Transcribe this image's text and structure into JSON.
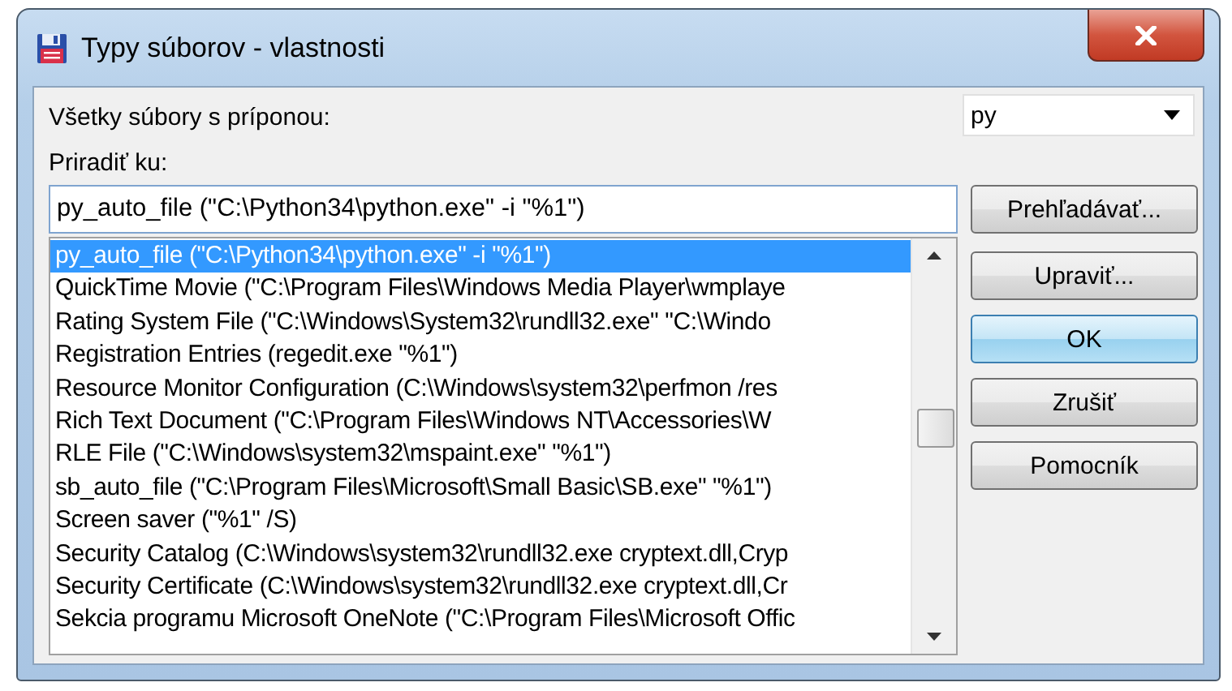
{
  "window": {
    "title": "Typy súborov - vlastnosti"
  },
  "extension_label": "Všetky súbory s príponou:",
  "extension_select": {
    "value": "py"
  },
  "assign_label": "Priradiť ku:",
  "assign_field": {
    "value": "py_auto_file (\"C:\\Python34\\python.exe\" -i \"%1\")"
  },
  "file_types": [
    {
      "text": "py_auto_file (\"C:\\Python34\\python.exe\" -i \"%1\")",
      "selected": true
    },
    {
      "text": "QuickTime Movie (\"C:\\Program Files\\Windows Media Player\\wmplaye",
      "selected": false
    },
    {
      "text": "Rating System File (\"C:\\Windows\\System32\\rundll32.exe\" \"C:\\Windo",
      "selected": false
    },
    {
      "text": "Registration Entries (regedit.exe \"%1\")",
      "selected": false
    },
    {
      "text": "Resource Monitor Configuration (C:\\Windows\\system32\\perfmon /res",
      "selected": false
    },
    {
      "text": "Rich Text Document (\"C:\\Program Files\\Windows NT\\Accessories\\W",
      "selected": false
    },
    {
      "text": "RLE File (\"C:\\Windows\\system32\\mspaint.exe\" \"%1\")",
      "selected": false
    },
    {
      "text": "sb_auto_file (\"C:\\Program Files\\Microsoft\\Small Basic\\SB.exe\" \"%1\")",
      "selected": false
    },
    {
      "text": "Screen saver (\"%1\" /S)",
      "selected": false
    },
    {
      "text": "Security Catalog (C:\\Windows\\system32\\rundll32.exe cryptext.dll,Cryp",
      "selected": false
    },
    {
      "text": "Security Certificate (C:\\Windows\\system32\\rundll32.exe cryptext.dll,Cr",
      "selected": false
    },
    {
      "text": "Sekcia programu Microsoft OneNote (\"C:\\Program Files\\Microsoft Offic",
      "selected": false
    }
  ],
  "buttons": [
    {
      "label": "Prehľadávať...",
      "default": false
    },
    {
      "label": "Upraviť...",
      "default": false
    },
    {
      "label": "OK",
      "default": true
    },
    {
      "label": "Zrušiť",
      "default": false
    },
    {
      "label": "Pomocník",
      "default": false
    }
  ]
}
